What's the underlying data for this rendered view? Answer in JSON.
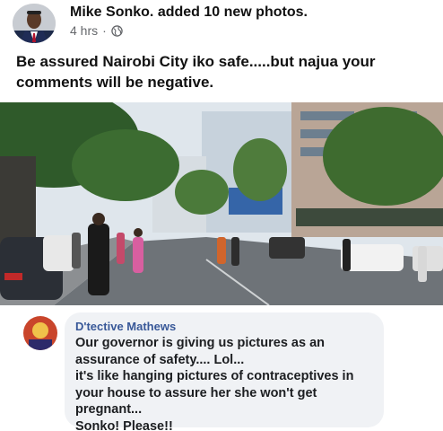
{
  "post": {
    "author": "Mike Sonko.",
    "action": "added 10 new photos.",
    "time": "4 hrs",
    "separator": "·",
    "audience_icon": "globe-icon",
    "text": "Be assured Nairobi City iko safe.....but najua your comments will be negative.",
    "photo": "street-scene-photo"
  },
  "comment": {
    "author": "D'tective Mathews",
    "text": "Our governor is giving us pictures as an assurance of safety.... Lol...\nit's like hanging pictures of contraceptives  in your house to assure her she won't get pregnant...\nSonko! Please!!"
  },
  "colors": {
    "link": "#385898",
    "bubble": "#f0f2f5",
    "meta": "#65676b"
  }
}
